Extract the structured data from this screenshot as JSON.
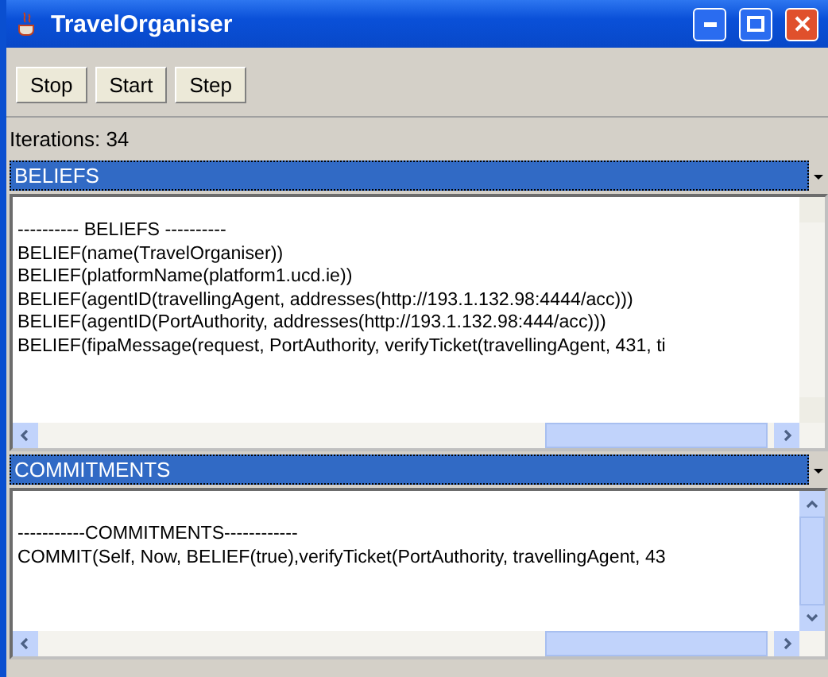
{
  "window": {
    "title": "TravelOrganiser"
  },
  "toolbar": {
    "buttons": [
      "Stop",
      "Start",
      "Step"
    ]
  },
  "iterations": "Iterations: 34",
  "panels": [
    {
      "selector": "BELIEFS",
      "lines": [
        "---------- BELIEFS ----------",
        "BELIEF(name(TravelOrganiser))",
        "BELIEF(platformName(platform1.ucd.ie))",
        "BELIEF(agentID(travellingAgent, addresses(http://193.1.132.98:4444/acc)))",
        "BELIEF(agentID(PortAuthority, addresses(http://193.1.132.98:444/acc)))",
        "BELIEF(fipaMessage(request, PortAuthority, verifyTicket(travellingAgent, 431, ti"
      ],
      "vertical_scroll_enabled": false
    },
    {
      "selector": "COMMITMENTS",
      "lines": [
        "-----------COMMITMENTS------------",
        "COMMIT(Self, Now, BELIEF(true),verifyTicket(PortAuthority, travellingAgent, 43"
      ],
      "vertical_scroll_enabled": true
    }
  ]
}
